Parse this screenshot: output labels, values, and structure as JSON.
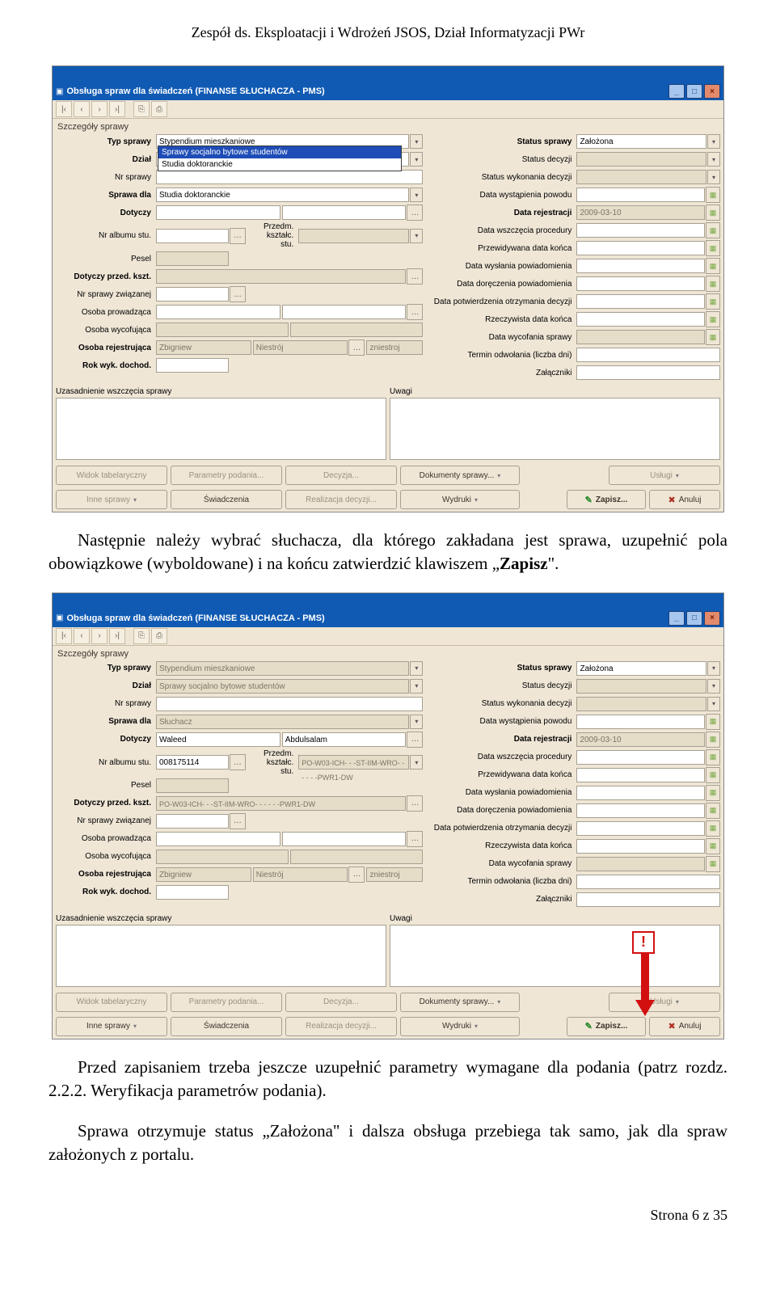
{
  "header": "Zespół ds. Eksploatacji i Wdrożeń JSOS, Dział Informatyzacji PWr",
  "footer": "Strona 6 z 35",
  "para1_pre": "Następnie należy wybrać słuchacza, dla którego zakładana jest sprawa, uzupełnić pola obowiązkowe (wyboldowane) i na końcu zatwierdzić klawiszem „",
  "para1_bold": "Zapisz",
  "para1_post": "\".",
  "para2": "Przed zapisaniem trzeba jeszcze uzupełnić parametry wymagane dla podania (patrz rozdz. 2.2.2. Weryfikacja parametrów podania).",
  "para3": "Sprawa otrzymuje status „Założona\" i dalsza obsługa przebiega tak samo, jak dla spraw założonych z portalu.",
  "win": {
    "title": "Obsługa spraw dla świadczeń (FINANSE SŁUCHACZA - PMS)",
    "section": "Szczegóły sprawy",
    "labels": {
      "typ": "Typ sprawy",
      "dzial": "Dział",
      "nr": "Nr sprawy",
      "sprawa_dla": "Sprawa dla",
      "dotyczy": "Dotyczy",
      "nr_albumu": "Nr albumu stu.",
      "pesel": "Pesel",
      "dotyczy_kszt": "Dotyczy przed. kszt.",
      "nr_zwiazanej": "Nr sprawy związanej",
      "osoba_prow": "Osoba prowadząca",
      "osoba_wyc": "Osoba wycofująca",
      "osoba_rej": "Osoba rejestrująca",
      "rok_dochod": "Rok wyk. dochod.",
      "przedm": "Przedm. kształc. stu.",
      "uzasadnienie": "Uzasadnienie wszczęcia sprawy",
      "uwagi": "Uwagi",
      "status_sprawy": "Status sprawy",
      "status_decyzji": "Status decyzji",
      "status_wyk": "Status wykonania decyzji",
      "data_wyst": "Data wystąpienia powodu",
      "data_rej": "Data rejestracji",
      "data_wszcz": "Data wszczęcia procedury",
      "przew_konca": "Przewidywana data końca",
      "data_wysl": "Data wysłania powiadomienia",
      "data_dor": "Data doręczenia powiadomienia",
      "data_potw": "Data potwierdzenia otrzymania decyzji",
      "rzecz_konca": "Rzeczywista data końca",
      "data_wycof": "Data wycofania sprawy",
      "termin_odw": "Termin odwołania (liczba dni)",
      "zalaczniki": "Załączniki"
    },
    "vals1": {
      "typ": "Stypendium mieszkaniowe",
      "dzial": "Studia doktoranckie",
      "sprawa_dla": "Studia doktoranckie",
      "dd_opt1": "Sprawy socjalno bytowe studentów",
      "dd_opt2": "Studia doktoranckie",
      "status": "Założona",
      "data_rej": "2009-03-10",
      "osoba_rej1": "Zbigniew",
      "osoba_rej2": "Niestrój",
      "osoba_rej3": "zniestroj"
    },
    "vals2": {
      "typ": "Stypendium mieszkaniowe",
      "dzial": "Sprawy socjalno bytowe studentów",
      "sprawa_dla": "Słuchacz",
      "dotyczy1": "Waleed",
      "dotyczy2": "Abdulsalam",
      "nr_albumu": "008175114",
      "przedm": "PO-W03-ICH- - -ST-IIM-WRO- - - - - -PWR1-DW",
      "kszt": "PO-W03-ICH- - -ST-IIM-WRO- - - - - -PWR1-DW",
      "status": "Założona",
      "data_rej": "2009-03-10",
      "osoba_rej1": "Zbigniew",
      "osoba_rej2": "Niestrój",
      "osoba_rej3": "zniestroj"
    },
    "buttons": {
      "widok": "Widok tabelaryczny",
      "param": "Parametry podania...",
      "decyzja": "Decyzja...",
      "dokumenty": "Dokumenty sprawy...",
      "uslugi": "Usługi",
      "inne": "Inne sprawy",
      "swiadczenia": "Świadczenia",
      "realizacja": "Realizacja decyzji...",
      "wydruki": "Wydruki",
      "zapisz": "Zapisz...",
      "anuluj": "Anuluj"
    }
  },
  "exclaim": "!"
}
